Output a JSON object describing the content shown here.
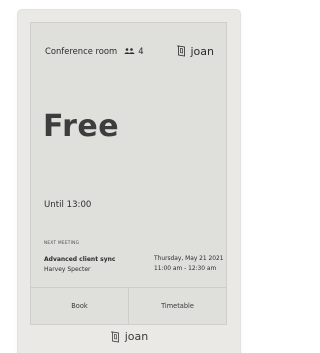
{
  "header": {
    "room_name": "Conference room",
    "capacity": "4",
    "brand": "joan"
  },
  "status": {
    "label": "Free",
    "until": "Until 13:00"
  },
  "next_meeting": {
    "section_label": "NEXT MEETING",
    "title": "Advanced client sync",
    "host": "Harvey Specter",
    "date": "Thursday, May 21 2021",
    "time": "11:00 am - 12:30 am"
  },
  "buttons": {
    "book": "Book",
    "timetable": "Timetable"
  },
  "footer": {
    "brand": "joan"
  },
  "colors": {
    "device_frame": "#eae9e5",
    "screen": "#dfe0dc",
    "text": "#2b2b2b"
  }
}
